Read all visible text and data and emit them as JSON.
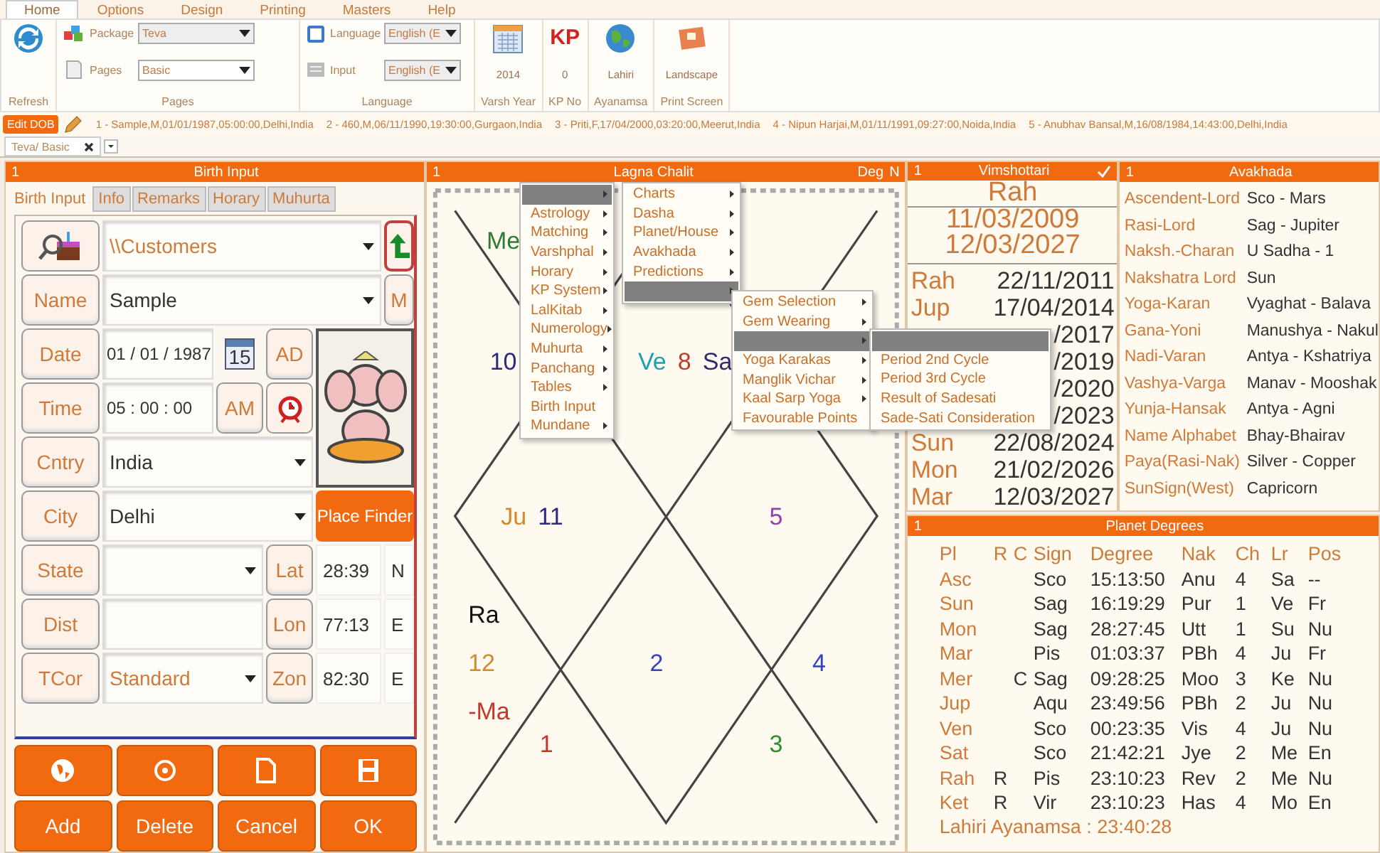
{
  "ribbon": {
    "tabs": [
      {
        "label": "Home",
        "selected": true
      },
      {
        "label": "Options",
        "selected": false
      },
      {
        "label": "Design",
        "selected": false
      },
      {
        "label": "Printing",
        "selected": false
      },
      {
        "label": "Masters",
        "selected": false
      },
      {
        "label": "Help",
        "selected": false
      }
    ],
    "refresh": "Refresh",
    "pages_group": {
      "title": "Pages",
      "package_label": "Package",
      "package_value": "Teva",
      "pages_label": "Pages",
      "pages_value": "Basic"
    },
    "language_group": {
      "title": "Language",
      "language_label": "Language",
      "language_value": "English (E",
      "input_label": "Input",
      "input_value": "English (E"
    },
    "tools": [
      {
        "kind": "calendar",
        "value": "2014",
        "label": "Varsh Year"
      },
      {
        "kind": "kp",
        "icon_text": "KP",
        "value": "0",
        "label": "KP No"
      },
      {
        "kind": "globe",
        "value": "Lahiri",
        "label": "Ayanamsa"
      },
      {
        "kind": "landscape",
        "value": "Landscape",
        "label": "Print Screen"
      }
    ]
  },
  "recent_bar": {
    "edit_button": "Edit DOB",
    "records": [
      "1 - Sample,M,01/01/1987,05:00:00,Delhi,India",
      "2 - 460,M,06/11/1990,19:30:00,Gurgaon,India",
      "3 - Priti,F,17/04/2000,03:20:00,Meerut,India",
      "4 - Nipun Harjai,M,01/11/1991,09:27:00,Noida,India",
      "5 - Anubhav Bansal,M,16/08/1984,14:43:00,Delhi,India"
    ]
  },
  "document_tab": {
    "label": "Teva/ Basic"
  },
  "birth_input": {
    "number": "1",
    "title": "Birth Input",
    "tabs": [
      {
        "label": "Birth Input",
        "selected": true
      },
      {
        "label": "Info",
        "selected": false
      },
      {
        "label": "Remarks",
        "selected": false
      },
      {
        "label": "Horary",
        "selected": false
      },
      {
        "label": "Muhurta",
        "selected": false
      }
    ],
    "customer_path": "\\\\Customers",
    "name": {
      "label": "Name",
      "value": "Sample"
    },
    "gender": "M",
    "date": {
      "label": "Date",
      "value": "01 / 01 / 1987"
    },
    "calendar_day": "15",
    "era": "AD",
    "time": {
      "label": "Time",
      "value": "05 : 00 : 00"
    },
    "meridiem": "AM",
    "country": {
      "label": "Cntry",
      "value": "India"
    },
    "city": {
      "label": "City",
      "value": "Delhi"
    },
    "place_finder": "Place Finder",
    "state": {
      "label": "State"
    },
    "lat": {
      "label": "Lat",
      "value": "28:39",
      "dir": "N"
    },
    "dist": {
      "label": "Dist"
    },
    "lon": {
      "label": "Lon",
      "value": "77:13",
      "dir": "E"
    },
    "tcor": {
      "label": "TCor",
      "value": "Standard"
    },
    "zone": {
      "label": "Zon",
      "value": "82:30",
      "dir": "E"
    },
    "buttons": [
      "Add",
      "Delete",
      "Cancel",
      "OK"
    ]
  },
  "chart": {
    "number": "1",
    "title": "Lagna Chalit",
    "deg": "Deg",
    "n": "N",
    "houses": [
      {
        "items": [
          {
            "text": "Ve",
            "color": "#19a2b4"
          },
          {
            "text": "8",
            "color": "#c0392b"
          },
          {
            "text": "Sa",
            "color": "#2c2c6e"
          }
        ]
      },
      {
        "items": [
          {
            "text": "Me",
            "color": "#2e7d32"
          }
        ]
      },
      {
        "items": [
          {
            "text": "10",
            "color": "#2a2a80"
          }
        ]
      },
      {
        "items": [
          {
            "text": "Ju",
            "color": "#d4892a"
          },
          {
            "text": "11",
            "color": "#2a2a80"
          }
        ]
      },
      {
        "items": [
          {
            "text": "Ra",
            "color": "#111111"
          },
          {
            "text": "12",
            "color": "#d4892a"
          },
          {
            "text": "-Ma",
            "color": "#c0392b"
          }
        ]
      },
      {
        "items": [
          {
            "text": "1",
            "color": "#c0392b"
          }
        ]
      },
      {
        "items": [
          {
            "text": "2",
            "color": "#3344bb"
          }
        ]
      },
      {
        "items": [
          {
            "text": "3",
            "color": "#2e8b2e"
          }
        ]
      },
      {
        "items": [
          {
            "text": "4",
            "color": "#3344bb"
          }
        ]
      },
      {
        "items": [
          {
            "text": "5",
            "color": "#8e44ad"
          }
        ]
      }
    ]
  },
  "vimshottari": {
    "number": "1",
    "title": "Vimshottari",
    "checked": true,
    "lord": "Rah",
    "start": "11/03/2009",
    "end": "12/03/2027",
    "rows": [
      {
        "lord": "Rah",
        "date": "22/11/2011"
      },
      {
        "lord": "Jup",
        "date": "17/04/2014"
      },
      {
        "date": "/2017"
      },
      {
        "date": "/2019"
      },
      {
        "date": "/2020"
      },
      {
        "date": "/2023"
      },
      {
        "lord": "Sun",
        "date": "22/08/2024"
      },
      {
        "lord": "Mon",
        "date": "21/02/2026"
      },
      {
        "lord": "Mar",
        "date": "12/03/2027"
      }
    ]
  },
  "avakhada": {
    "number": "1",
    "title": "Avakhada",
    "rows": [
      {
        "label": "Ascendent-Lord",
        "value": "Sco - Mars"
      },
      {
        "label": "Rasi-Lord",
        "value": "Sag - Jupiter"
      },
      {
        "label": "Naksh.-Charan",
        "value": "U Sadha - 1"
      },
      {
        "label": "Nakshatra Lord",
        "value": "Sun"
      },
      {
        "label": "Yoga-Karan",
        "value": "Vyaghat - Balava"
      },
      {
        "label": "Gana-Yoni",
        "value": "Manushya - Nakul"
      },
      {
        "label": "Nadi-Varan",
        "value": "Antya - Kshatriya"
      },
      {
        "label": "Vashya-Varga",
        "value": "Manav - Mooshak"
      },
      {
        "label": "Yunja-Hansak",
        "value": "Antya - Agni"
      },
      {
        "label": "Name Alphabet",
        "value": "Bhay-Bhairav"
      },
      {
        "label": "Paya(Rasi-Nak)",
        "value": "Silver - Copper"
      },
      {
        "label": "SunSign(West)",
        "value": "Capricorn"
      }
    ]
  },
  "planet_degrees": {
    "number": "1",
    "title": "Planet Degrees",
    "columns": [
      "Pl",
      "R",
      "C",
      "Sign",
      "Degree",
      "Nak",
      "Ch",
      "Lr",
      "Pos"
    ],
    "rows": [
      [
        "Asc",
        "",
        "",
        "Sco",
        "15:13:50",
        "Anu",
        "4",
        "Sa",
        "--"
      ],
      [
        "Sun",
        "",
        "",
        "Sag",
        "16:19:29",
        "Pur",
        "1",
        "Ve",
        "Fr"
      ],
      [
        "Mon",
        "",
        "",
        "Sag",
        "28:27:45",
        "Utt",
        "1",
        "Su",
        "Nu"
      ],
      [
        "Mar",
        "",
        "",
        "Pis",
        "01:03:37",
        "PBh",
        "4",
        "Ju",
        "Fr"
      ],
      [
        "Mer",
        "",
        "C",
        "Sag",
        "09:28:25",
        "Moo",
        "3",
        "Ke",
        "Nu"
      ],
      [
        "Jup",
        "",
        "",
        "Aqu",
        "23:49:56",
        "PBh",
        "2",
        "Ju",
        "Nu"
      ],
      [
        "Ven",
        "",
        "",
        "Sco",
        "00:23:35",
        "Vis",
        "4",
        "Ju",
        "Nu"
      ],
      [
        "Sat",
        "",
        "",
        "Sco",
        "21:42:21",
        "Jye",
        "2",
        "Me",
        "En"
      ],
      [
        "Rah",
        "R",
        "",
        "Pis",
        "23:10:23",
        "Rev",
        "2",
        "Me",
        "Nu"
      ],
      [
        "Ket",
        "R",
        "",
        "Vir",
        "23:10:23",
        "Has",
        "4",
        "Mo",
        "En"
      ]
    ],
    "footer": "Lahiri Ayanamsa : 23:40:28"
  },
  "context_menus": [
    {
      "items": [
        {
          "selected": true,
          "submenu": true
        },
        {
          "label": "Astrology",
          "selected": false,
          "submenu": true
        },
        {
          "label": "Matching",
          "selected": false,
          "submenu": true
        },
        {
          "label": "Varshphal",
          "selected": false,
          "submenu": true
        },
        {
          "label": "Horary",
          "selected": false,
          "submenu": true
        },
        {
          "label": "KP System",
          "selected": false,
          "submenu": true
        },
        {
          "label": "LalKitab",
          "selected": false,
          "submenu": true
        },
        {
          "label": "Numerology",
          "selected": false,
          "submenu": true
        },
        {
          "label": "Muhurta",
          "selected": false,
          "submenu": true
        },
        {
          "label": "Panchang",
          "selected": false,
          "submenu": true
        },
        {
          "label": "Tables",
          "selected": false,
          "submenu": true
        },
        {
          "label": "Birth Input",
          "selected": false,
          "submenu": false
        },
        {
          "label": "Mundane",
          "selected": false,
          "submenu": true
        }
      ]
    },
    {
      "items": [
        {
          "label": "Charts",
          "selected": false,
          "submenu": true
        },
        {
          "label": "Dasha",
          "selected": false,
          "submenu": true
        },
        {
          "label": "Planet/House",
          "selected": false,
          "submenu": true
        },
        {
          "label": "Avakhada",
          "selected": false,
          "submenu": true
        },
        {
          "label": "Predictions",
          "selected": false,
          "submenu": true
        },
        {
          "selected": true,
          "submenu": true
        }
      ]
    },
    {
      "items": [
        {
          "label": "Gem Selection",
          "selected": false,
          "submenu": true
        },
        {
          "label": "Gem Wearing",
          "selected": false,
          "submenu": true
        },
        {
          "selected": true,
          "submenu": true
        },
        {
          "label": "Yoga Karakas",
          "selected": false,
          "submenu": true
        },
        {
          "label": "Manglik Vichar",
          "selected": false,
          "submenu": true
        },
        {
          "label": "Kaal Sarp Yoga",
          "selected": false,
          "submenu": true
        },
        {
          "label": "Favourable Points",
          "selected": false,
          "submenu": false
        }
      ]
    },
    {
      "items": [
        {
          "selected": true,
          "submenu": false
        },
        {
          "label": "Period 2nd Cycle",
          "selected": false,
          "submenu": false
        },
        {
          "label": "Period 3rd Cycle",
          "selected": false,
          "submenu": false
        },
        {
          "label": "Result of Sadesati",
          "selected": false,
          "submenu": false
        },
        {
          "label": "Sade-Sati Consideration",
          "selected": false,
          "submenu": false
        }
      ]
    }
  ]
}
